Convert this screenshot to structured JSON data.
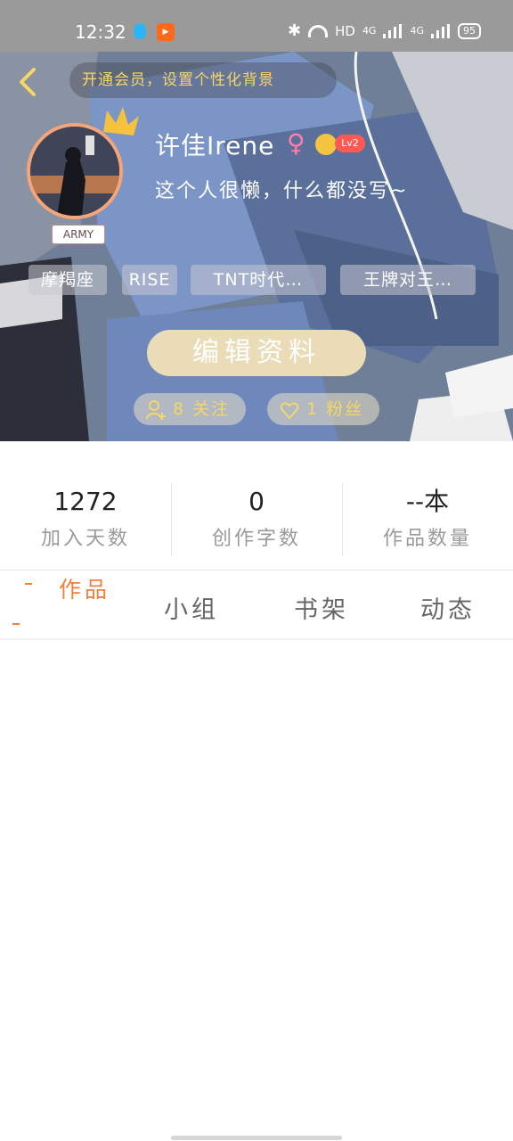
{
  "status_bar": {
    "time": "12:32",
    "network_label": "HD",
    "signal1": "4G",
    "signal2": "4G",
    "battery": "95"
  },
  "header": {
    "vip_banner": "开通会员，设置个性化背景",
    "avatar_tag": "ARMY",
    "nickname": "许佳Irene",
    "gender_symbol": "♀",
    "level": "Lv2",
    "bio": "这个人很懒，什么都没写~"
  },
  "tags": [
    "摩羯座",
    "RISE",
    "TNT时代…",
    "王牌对王…"
  ],
  "actions": {
    "edit_label": "编辑资料",
    "following_label": "8 关注",
    "followers_label": "1 粉丝"
  },
  "stats": [
    {
      "value": "1272",
      "label": "加入天数"
    },
    {
      "value": "0",
      "label": "创作字数"
    },
    {
      "value": "--本",
      "label": "作品数量"
    }
  ],
  "tabs": [
    {
      "label": "作品",
      "active": true
    },
    {
      "label": "小组",
      "active": false
    },
    {
      "label": "书架",
      "active": false
    },
    {
      "label": "动态",
      "active": false
    }
  ],
  "colors": {
    "accent": "#f08040",
    "vip_gold": "#f6d766",
    "edit_button": "#e9dcb7",
    "level_badge": "#ff5a52"
  }
}
